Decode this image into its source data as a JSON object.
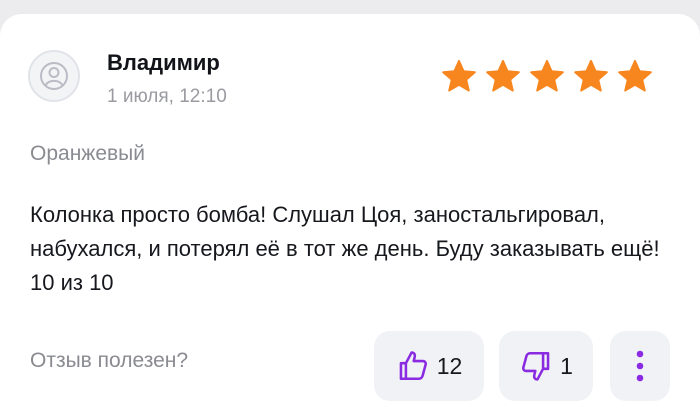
{
  "review": {
    "author": "Владимир",
    "date": "1 июля, 12:10",
    "rating": 5,
    "rating_max": 5,
    "variant": "Оранжевый",
    "text": "Колонка просто бомба! Слушал Цоя, заностальгировал, набухался, и потерял её в тот же день. Буду заказывать ещё! 10 из 10"
  },
  "feedback": {
    "helpful_label": "Отзыв полезен?",
    "likes": "12",
    "dislikes": "1"
  },
  "colors": {
    "star": "#f7861e",
    "accent": "#8a2be2",
    "pill_bg": "#f1f2f6"
  },
  "icons": {
    "avatar": "user-icon",
    "rating": "star-icon",
    "like": "thumbs-up-icon",
    "dislike": "thumbs-down-icon",
    "more": "more-vertical-icon"
  }
}
